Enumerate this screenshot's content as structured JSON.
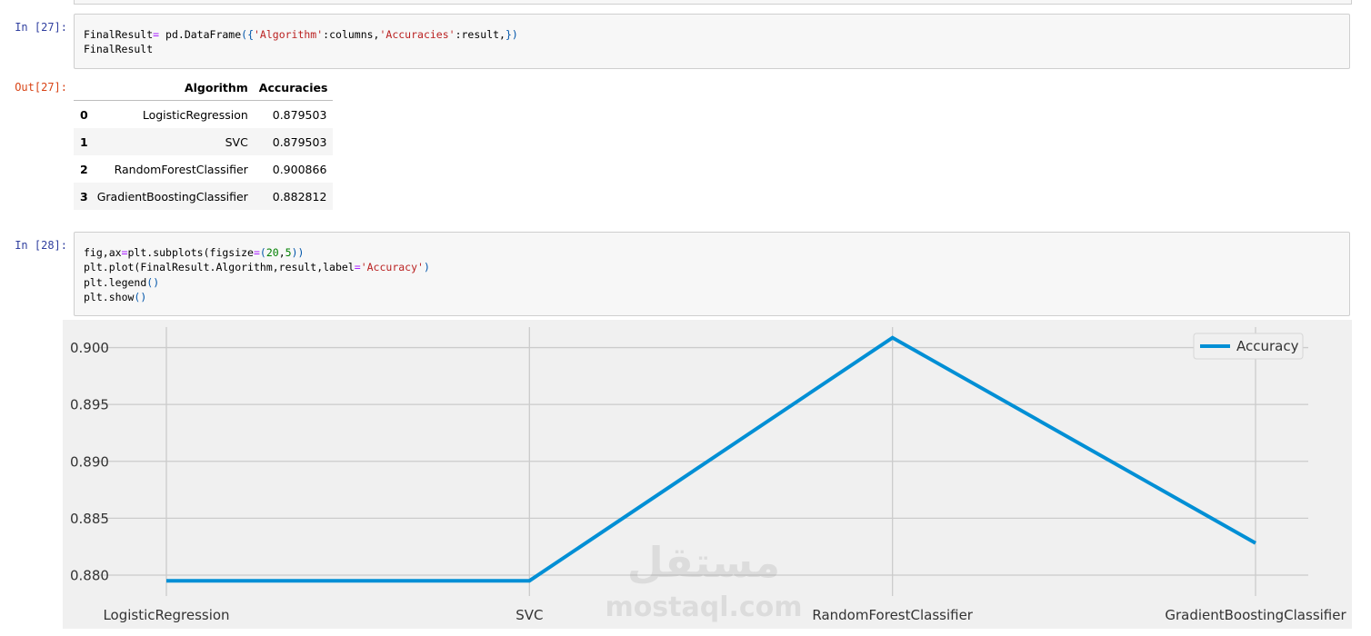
{
  "cell_27": {
    "in_prompt": "In [27]:",
    "code": [
      [
        {
          "t": "FinalResult"
        },
        {
          "t": "=",
          "c": "o"
        },
        {
          "t": " pd"
        },
        {
          "t": "."
        },
        {
          "t": "DataFrame"
        },
        {
          "t": "({",
          "c": "p"
        },
        {
          "t": "'Algorithm'",
          "c": "s"
        },
        {
          "t": ":columns,"
        },
        {
          "t": "'Accuracies'",
          "c": "s"
        },
        {
          "t": ":result,"
        },
        {
          "t": "})",
          "c": "p"
        }
      ],
      [
        {
          "t": "FinalResult"
        }
      ]
    ],
    "out_prompt": "Out[27]:"
  },
  "dataframe": {
    "columns": [
      "",
      "Algorithm",
      "Accuracies"
    ],
    "rows": [
      {
        "index": "0",
        "algorithm": "LogisticRegression",
        "accuracy": "0.879503"
      },
      {
        "index": "1",
        "algorithm": "SVC",
        "accuracy": "0.879503"
      },
      {
        "index": "2",
        "algorithm": "RandomForestClassifier",
        "accuracy": "0.900866"
      },
      {
        "index": "3",
        "algorithm": "GradientBoostingClassifier",
        "accuracy": "0.882812"
      }
    ]
  },
  "cell_28": {
    "in_prompt": "In [28]:",
    "code": [
      [
        {
          "t": "fig,ax"
        },
        {
          "t": "=",
          "c": "o"
        },
        {
          "t": "plt"
        },
        {
          "t": "."
        },
        {
          "t": "subplots(figsize"
        },
        {
          "t": "=",
          "c": "o"
        },
        {
          "t": "(",
          "c": "p"
        },
        {
          "t": "20",
          "c": "n"
        },
        {
          "t": ","
        },
        {
          "t": "5",
          "c": "n"
        },
        {
          "t": "))",
          "c": "p"
        }
      ],
      [
        {
          "t": "plt"
        },
        {
          "t": "."
        },
        {
          "t": "plot(FinalResult"
        },
        {
          "t": "."
        },
        {
          "t": "Algorithm,result,label"
        },
        {
          "t": "=",
          "c": "o"
        },
        {
          "t": "'Accuracy'",
          "c": "s"
        },
        {
          "t": ")",
          "c": "p"
        }
      ],
      [
        {
          "t": "plt"
        },
        {
          "t": "."
        },
        {
          "t": "legend"
        },
        {
          "t": "()",
          "c": "p"
        }
      ],
      [
        {
          "t": "plt"
        },
        {
          "t": "."
        },
        {
          "t": "show"
        },
        {
          "t": "()",
          "c": "p"
        }
      ]
    ]
  },
  "chart_data": {
    "type": "line",
    "categories": [
      "LogisticRegression",
      "SVC",
      "RandomForestClassifier",
      "GradientBoostingClassifier"
    ],
    "series": [
      {
        "name": "Accuracy",
        "values": [
          0.879503,
          0.879503,
          0.900866,
          0.882812
        ],
        "color": "#008fd5"
      }
    ],
    "yticks": [
      "0.880",
      "0.885",
      "0.890",
      "0.895",
      "0.900"
    ],
    "ylim": [
      0.8788,
      0.9018
    ],
    "grid": true,
    "legend_position": "top-right",
    "background": "#f0f0f0",
    "grid_color": "#cbcbcb",
    "title": "",
    "xlabel": "",
    "ylabel": ""
  },
  "watermark": {
    "logo_text": "مستقل",
    "site_text": "mostaql.com"
  }
}
